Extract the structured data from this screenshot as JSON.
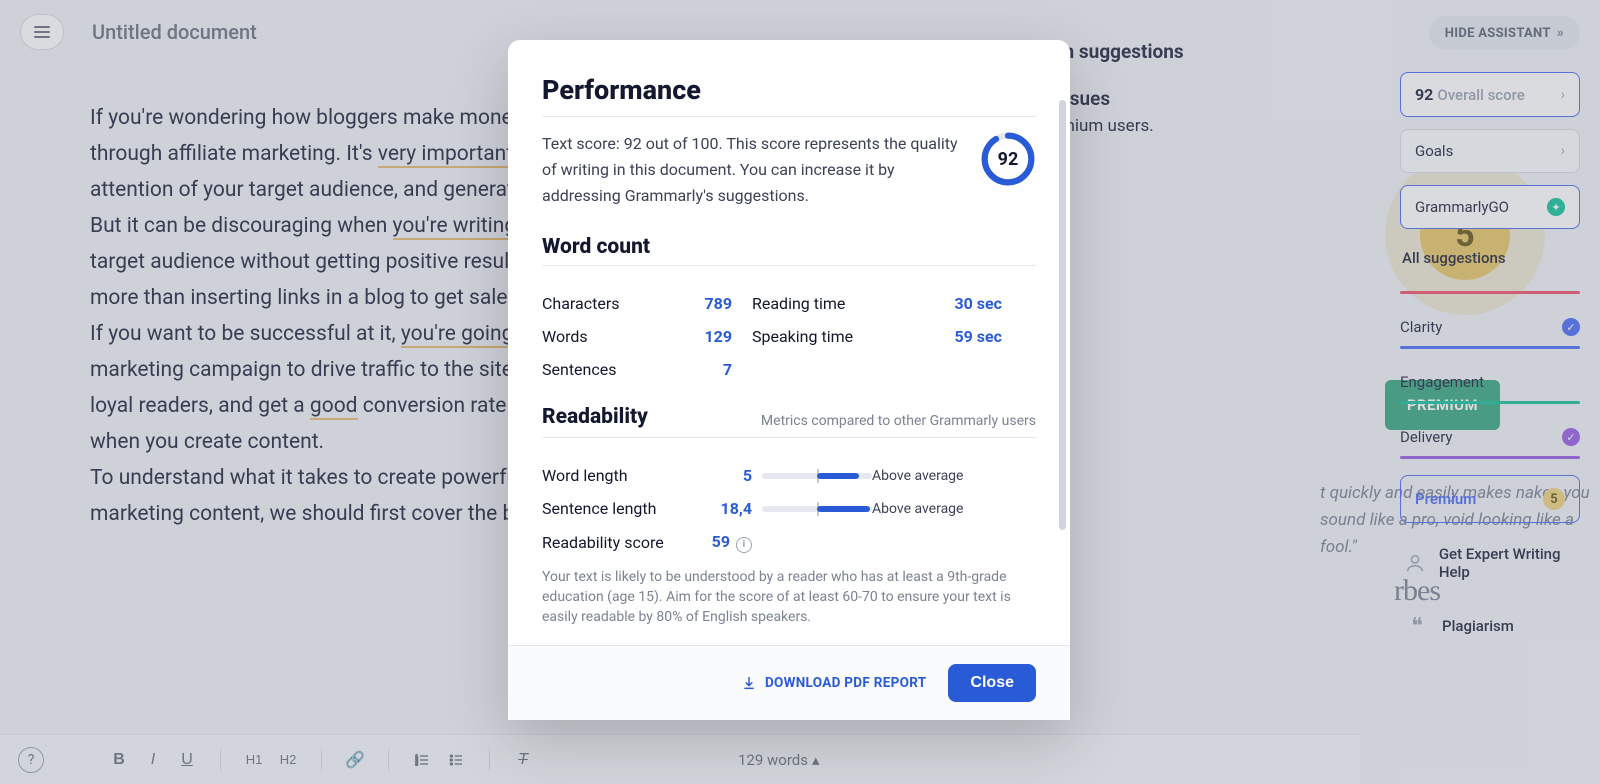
{
  "header": {
    "doc_title": "Untitled document",
    "hide_assistant": "HIDE ASSISTANT"
  },
  "editor": {
    "text": "If you're wondering how bloggers make money — usually, it happens through affiliate marketing. It's very important to grab the attention of your target audience, and generate sales this way. But it can be discouraging when you're writing article for your target audience without getting positive results. You need more than inserting links in a blog to get sales through your content. If you want to be successful at it, you're going to have to create marketing campaign to drive traffic to the site, get subscribers and loyal readers, and get a good conversion rate. You need a strategy when you create content.\nTo understand what it takes to create powerful affiliate marketing content, we should first cover the basics of",
    "underlines": [
      {
        "text": "very important",
        "class": "u-yellow"
      },
      {
        "text": "you're writing",
        "class": "u-yellow"
      },
      {
        "text": "you're going t",
        "class": "u-yellow"
      },
      {
        "text": "good",
        "class": "u-orange"
      }
    ]
  },
  "premium_panel": {
    "title": "Premium suggestions",
    "issues_label": "ssues",
    "subline": "mium users.",
    "count": "5",
    "button": "PREMIUM",
    "quote": "t quickly and easily makes nakes you sound like a pro, void looking like a fool.\"",
    "brand": "rbes"
  },
  "sidebar": {
    "score": "92",
    "score_label": "Overall score",
    "goals": "Goals",
    "ggo": "GrammarlyGO",
    "all_suggestions": "All suggestions",
    "cats": {
      "clarity": "Clarity",
      "engagement": "Engagement",
      "delivery": "Delivery"
    },
    "premium": "Premium",
    "premium_badge": "5",
    "expert": "Get Expert Writing Help",
    "plagiarism": "Plagiarism"
  },
  "bottombar": {
    "word_count": "129 words"
  },
  "modal": {
    "performance": {
      "title": "Performance",
      "body": "Text score: 92 out of 100. This score represents the quality of writing in this document. You can increase it by addressing Grammarly's suggestions.",
      "score": "92"
    },
    "wordcount": {
      "title": "Word count",
      "characters_k": "Characters",
      "characters_v": "789",
      "words_k": "Words",
      "words_v": "129",
      "sentences_k": "Sentences",
      "sentences_v": "7",
      "reading_k": "Reading time",
      "reading_v": "30 sec",
      "speaking_k": "Speaking time",
      "speaking_v": "59 sec"
    },
    "readability": {
      "title": "Readability",
      "hint": "Metrics compared to other Grammarly users",
      "wordlen_k": "Word length",
      "wordlen_v": "5",
      "wordlen_cmp": "Above average",
      "sentlen_k": "Sentence length",
      "sentlen_v": "18,4",
      "sentlen_cmp": "Above average",
      "score_k": "Readability score",
      "score_v": "59",
      "note": "Your text is likely to be understood by a reader who has at least a 9th-grade education (age 15). Aim for the score of at least 60-70 to ensure your text is easily readable by 80% of English speakers."
    },
    "footer": {
      "download": "DOWNLOAD PDF REPORT",
      "close": "Close"
    }
  }
}
